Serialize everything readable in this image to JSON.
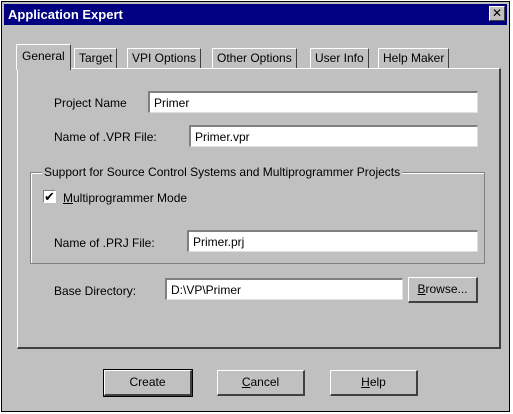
{
  "window": {
    "title": "Application Expert",
    "close_glyph": "✕"
  },
  "tabs": [
    {
      "label": "General",
      "active": true
    },
    {
      "label": "Target",
      "active": false
    },
    {
      "label": "VPI Options",
      "active": false
    },
    {
      "label": "Other Options",
      "active": false
    },
    {
      "label": "User Info",
      "active": false
    },
    {
      "label": "Help Maker",
      "active": false
    }
  ],
  "general": {
    "project_name_label": "Project Name",
    "project_name_value": "Primer",
    "vpr_file_label": "Name of .VPR File:",
    "vpr_file_value": "Primer.vpr",
    "group_title": "Support for Source Control Systems and Multiprogrammer Projects",
    "multiprogrammer_label": "Multiprogrammer Mode",
    "multiprogrammer_checked": true,
    "prj_file_label": "Name of .PRJ File:",
    "prj_file_value": "Primer.prj",
    "base_dir_label": "Base Directory:",
    "base_dir_value": "D:\\VP\\Primer",
    "browse_label": "Browse..."
  },
  "footer": {
    "create_label": "Create",
    "cancel_label": "Cancel",
    "help_label": "Help"
  }
}
